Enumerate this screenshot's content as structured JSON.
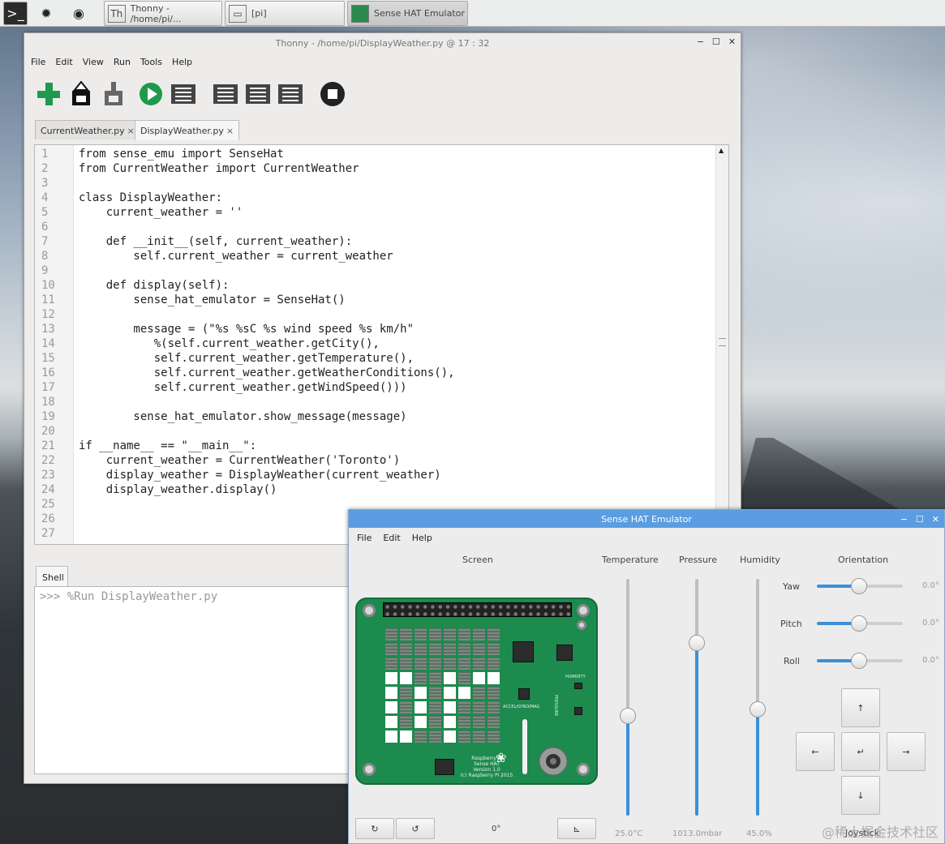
{
  "taskbar": {
    "tasks": [
      {
        "label": "Thonny  -  /home/pi/..."
      },
      {
        "label": "[pi]"
      },
      {
        "label": "Sense HAT Emulator"
      }
    ]
  },
  "thonny": {
    "title": "Thonny  -  /home/pi/DisplayWeather.py  @  17 : 32",
    "menu": [
      "File",
      "Edit",
      "View",
      "Run",
      "Tools",
      "Help"
    ],
    "tabs": [
      "CurrentWeather.py",
      "DisplayWeather.py"
    ],
    "tab_close": "×",
    "active_tab": 1,
    "line_numbers": [
      "1",
      "2",
      "3",
      "4",
      "5",
      "6",
      "7",
      "8",
      "9",
      "10",
      "11",
      "12",
      "13",
      "14",
      "15",
      "16",
      "17",
      "18",
      "19",
      "20",
      "21",
      "22",
      "23",
      "24",
      "25",
      "26",
      "27"
    ],
    "code_lines": [
      "from sense_emu import SenseHat",
      "from CurrentWeather import CurrentWeather",
      "",
      "class DisplayWeather:",
      "    current_weather = ''",
      "",
      "    def __init__(self, current_weather):",
      "        self.current_weather = current_weather",
      "",
      "    def display(self):",
      "        sense_hat_emulator = SenseHat()",
      "",
      "        message = (\"%s %sC %s wind speed %s km/h\"",
      "           %(self.current_weather.getCity(),",
      "           self.current_weather.getTemperature(),",
      "           self.current_weather.getWeatherConditions(),",
      "           self.current_weather.getWindSpeed()))",
      "",
      "        sense_hat_emulator.show_message(message)",
      "",
      "if __name__ == \"__main__\":",
      "    current_weather = CurrentWeather('Toronto')",
      "    display_weather = DisplayWeather(current_weather)",
      "    display_weather.display()",
      "",
      "",
      ""
    ],
    "shell_tab": "Shell",
    "shell_line": ">>> %Run DisplayWeather.py"
  },
  "sense": {
    "title": "Sense HAT Emulator",
    "menu": [
      "File",
      "Edit",
      "Help"
    ],
    "screen_label": "Screen",
    "temperature_label": "Temperature",
    "pressure_label": "Pressure",
    "humidity_label": "Humidity",
    "orientation_label": "Orientation",
    "yaw_label": "Yaw",
    "pitch_label": "Pitch",
    "roll_label": "Roll",
    "yaw_value": "0.0°",
    "pitch_value": "0.0°",
    "roll_value": "0.0°",
    "temperature_value": "25.0°C",
    "pressure_value": "1013.0mbar",
    "humidity_value": "45.0%",
    "temperature_level": 0.42,
    "pressure_level": 0.73,
    "humidity_level": 0.45,
    "rotation_value": "0°",
    "joystick_label": "Joystick",
    "board_text_humidity": "HUMIDITY",
    "board_text_pressure": "PRESSURE",
    "board_text_accel": "ACCEL/GYRO/MAG",
    "board_caption": [
      "Raspberry Pi",
      "Sense HAT",
      "Version 1.0",
      "(c) Raspberry Pi 2015"
    ],
    "led_on": [
      [
        0,
        0,
        0,
        0,
        0,
        0,
        0,
        0
      ],
      [
        0,
        0,
        0,
        0,
        0,
        0,
        0,
        0
      ],
      [
        0,
        0,
        0,
        0,
        0,
        0,
        0,
        0
      ],
      [
        1,
        1,
        0,
        0,
        1,
        0,
        1,
        1
      ],
      [
        1,
        0,
        1,
        0,
        1,
        1,
        0,
        0
      ],
      [
        1,
        0,
        1,
        0,
        1,
        0,
        0,
        0
      ],
      [
        1,
        0,
        1,
        0,
        1,
        0,
        0,
        0
      ],
      [
        1,
        1,
        0,
        0,
        1,
        0,
        0,
        0
      ]
    ],
    "colors": {
      "accent": "#3d8fd8",
      "board": "#1d8a4e",
      "title": "#5a9de0"
    }
  },
  "watermark": "@稀土掘金技术社区"
}
